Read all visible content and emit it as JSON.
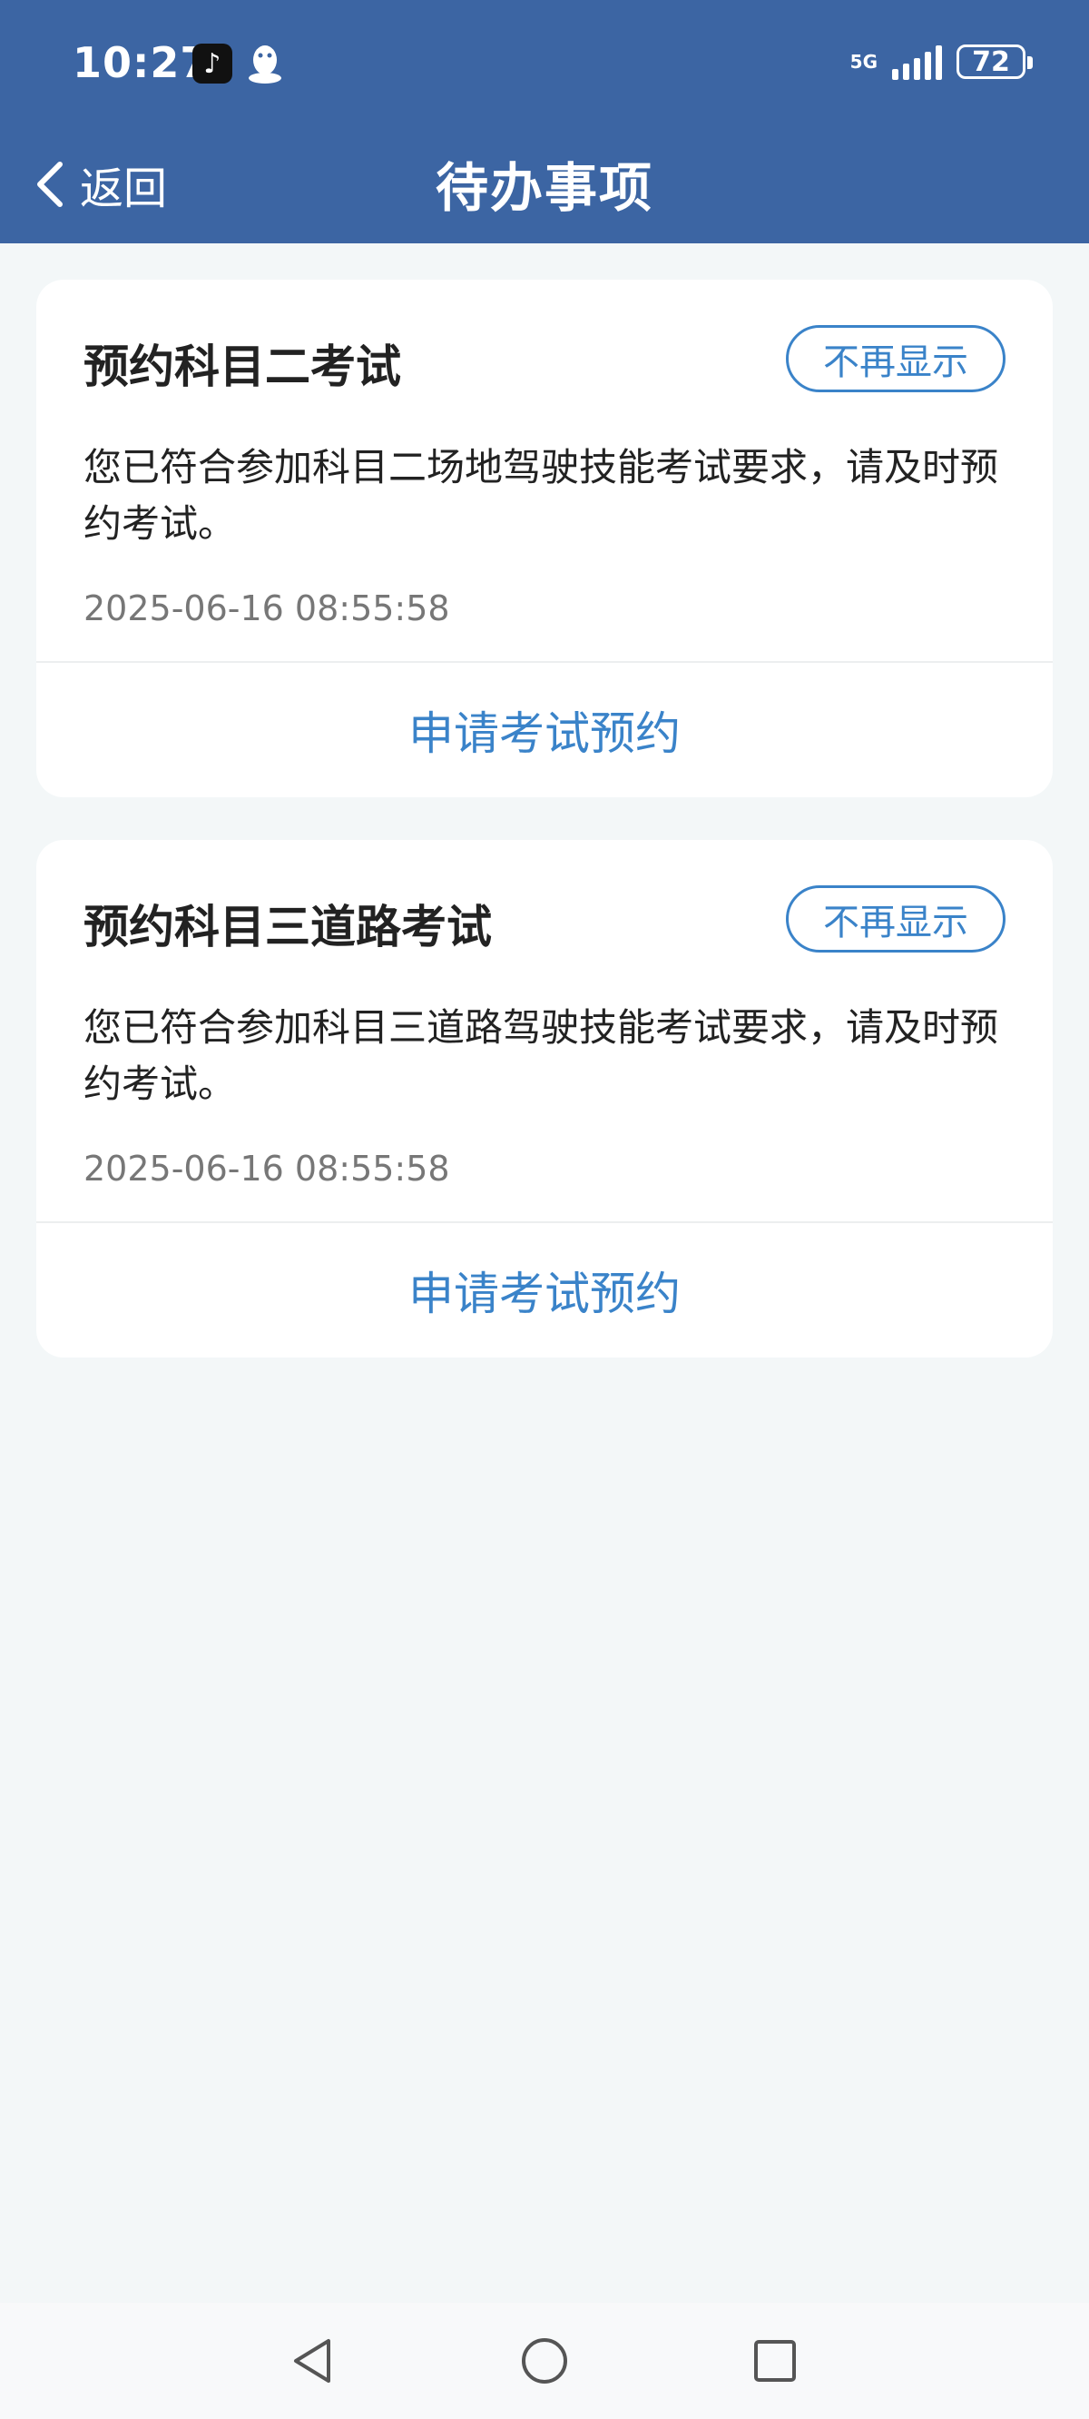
{
  "status_bar": {
    "time": "10:27",
    "network": "5G",
    "battery": "72",
    "apps": [
      "tiktok-icon",
      "qq-icon"
    ]
  },
  "nav": {
    "back_label": "返回",
    "title": "待办事项"
  },
  "colors": {
    "header_bg": "#3c65a3",
    "accent": "#3a83c9",
    "page_bg": "#f3f7f8"
  },
  "cards": [
    {
      "title": "预约科目二考试",
      "dismiss_label": "不再显示",
      "description": "您已符合参加科目二场地驾驶技能考试要求，请及时预约考试。",
      "timestamp": "2025-06-16 08:55:58",
      "action_label": "申请考试预约"
    },
    {
      "title": "预约科目三道路考试",
      "dismiss_label": "不再显示",
      "description": "您已符合参加科目三道路驾驶技能考试要求，请及时预约考试。",
      "timestamp": "2025-06-16 08:55:58",
      "action_label": "申请考试预约"
    }
  ],
  "system_nav": [
    "back-triangle-icon",
    "home-circle-icon",
    "recents-square-icon"
  ]
}
